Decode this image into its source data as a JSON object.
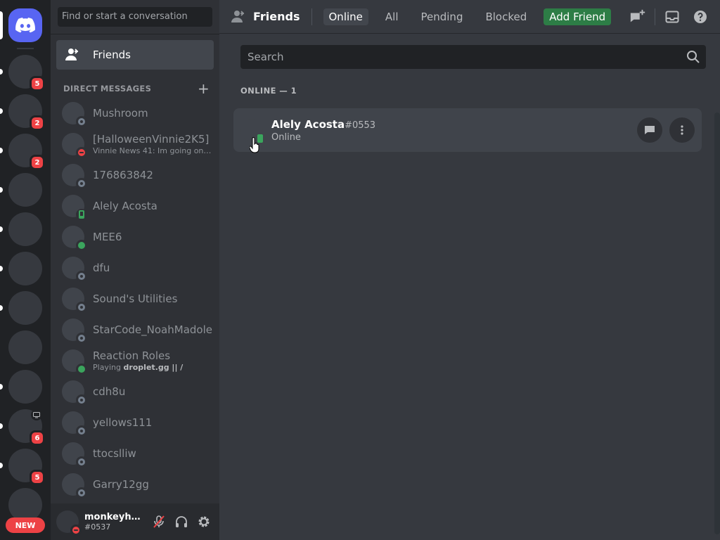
{
  "app": {
    "accent": "#5865f2",
    "dnd": "#ed4245",
    "online": "#3ba55d"
  },
  "server_rail": {
    "badges": [
      {
        "count": "5"
      },
      {
        "count": "2"
      },
      {
        "count": "2"
      },
      {
        "count": "6"
      },
      {
        "count": "5"
      }
    ],
    "new_label": "NEW"
  },
  "dm_panel": {
    "search_placeholder": "Find or start a conversation",
    "friends_label": "Friends",
    "direct_messages_header": "DIRECT MESSAGES",
    "items": [
      {
        "name": "Mushroom",
        "sub": "",
        "status": "offline"
      },
      {
        "name": "[HalloweenVinnie2K5]",
        "sub": "Vinnie News 41: Im going on a ...",
        "status": "dnd"
      },
      {
        "name": "176863842",
        "sub": "",
        "status": "offline"
      },
      {
        "name": "Alely Acosta",
        "sub": "",
        "status": "mobile"
      },
      {
        "name": "MEE6",
        "sub": "",
        "status": "online"
      },
      {
        "name": "dfu",
        "sub": "",
        "status": "offline"
      },
      {
        "name": "Sound's Utilities",
        "sub": "",
        "status": "offline"
      },
      {
        "name": "StarCode_NoahMadole",
        "sub": "",
        "status": "offline"
      },
      {
        "name": "Reaction Roles",
        "sub_prefix": "Playing ",
        "sub_bold": "droplet.gg || /",
        "status": "online"
      },
      {
        "name": "cdh8u",
        "sub": "",
        "status": "offline"
      },
      {
        "name": "yellows111",
        "sub": "",
        "status": "offline"
      },
      {
        "name": "ttocslliw",
        "sub": "",
        "status": "offline"
      },
      {
        "name": "Garry12gg",
        "sub": "",
        "status": "offline"
      }
    ]
  },
  "user_panel": {
    "username": "monkeyhal...",
    "tag": "#0537"
  },
  "header": {
    "title": "Friends",
    "tabs": [
      {
        "label": "Online",
        "active": true
      },
      {
        "label": "All"
      },
      {
        "label": "Pending"
      },
      {
        "label": "Blocked"
      }
    ],
    "add_friend_label": "Add Friend"
  },
  "friends_list": {
    "search_placeholder": "Search",
    "section_header": "ONLINE — 1",
    "friends": [
      {
        "name": "Alely Acosta",
        "tag": "#0553",
        "status": "Online"
      }
    ]
  }
}
